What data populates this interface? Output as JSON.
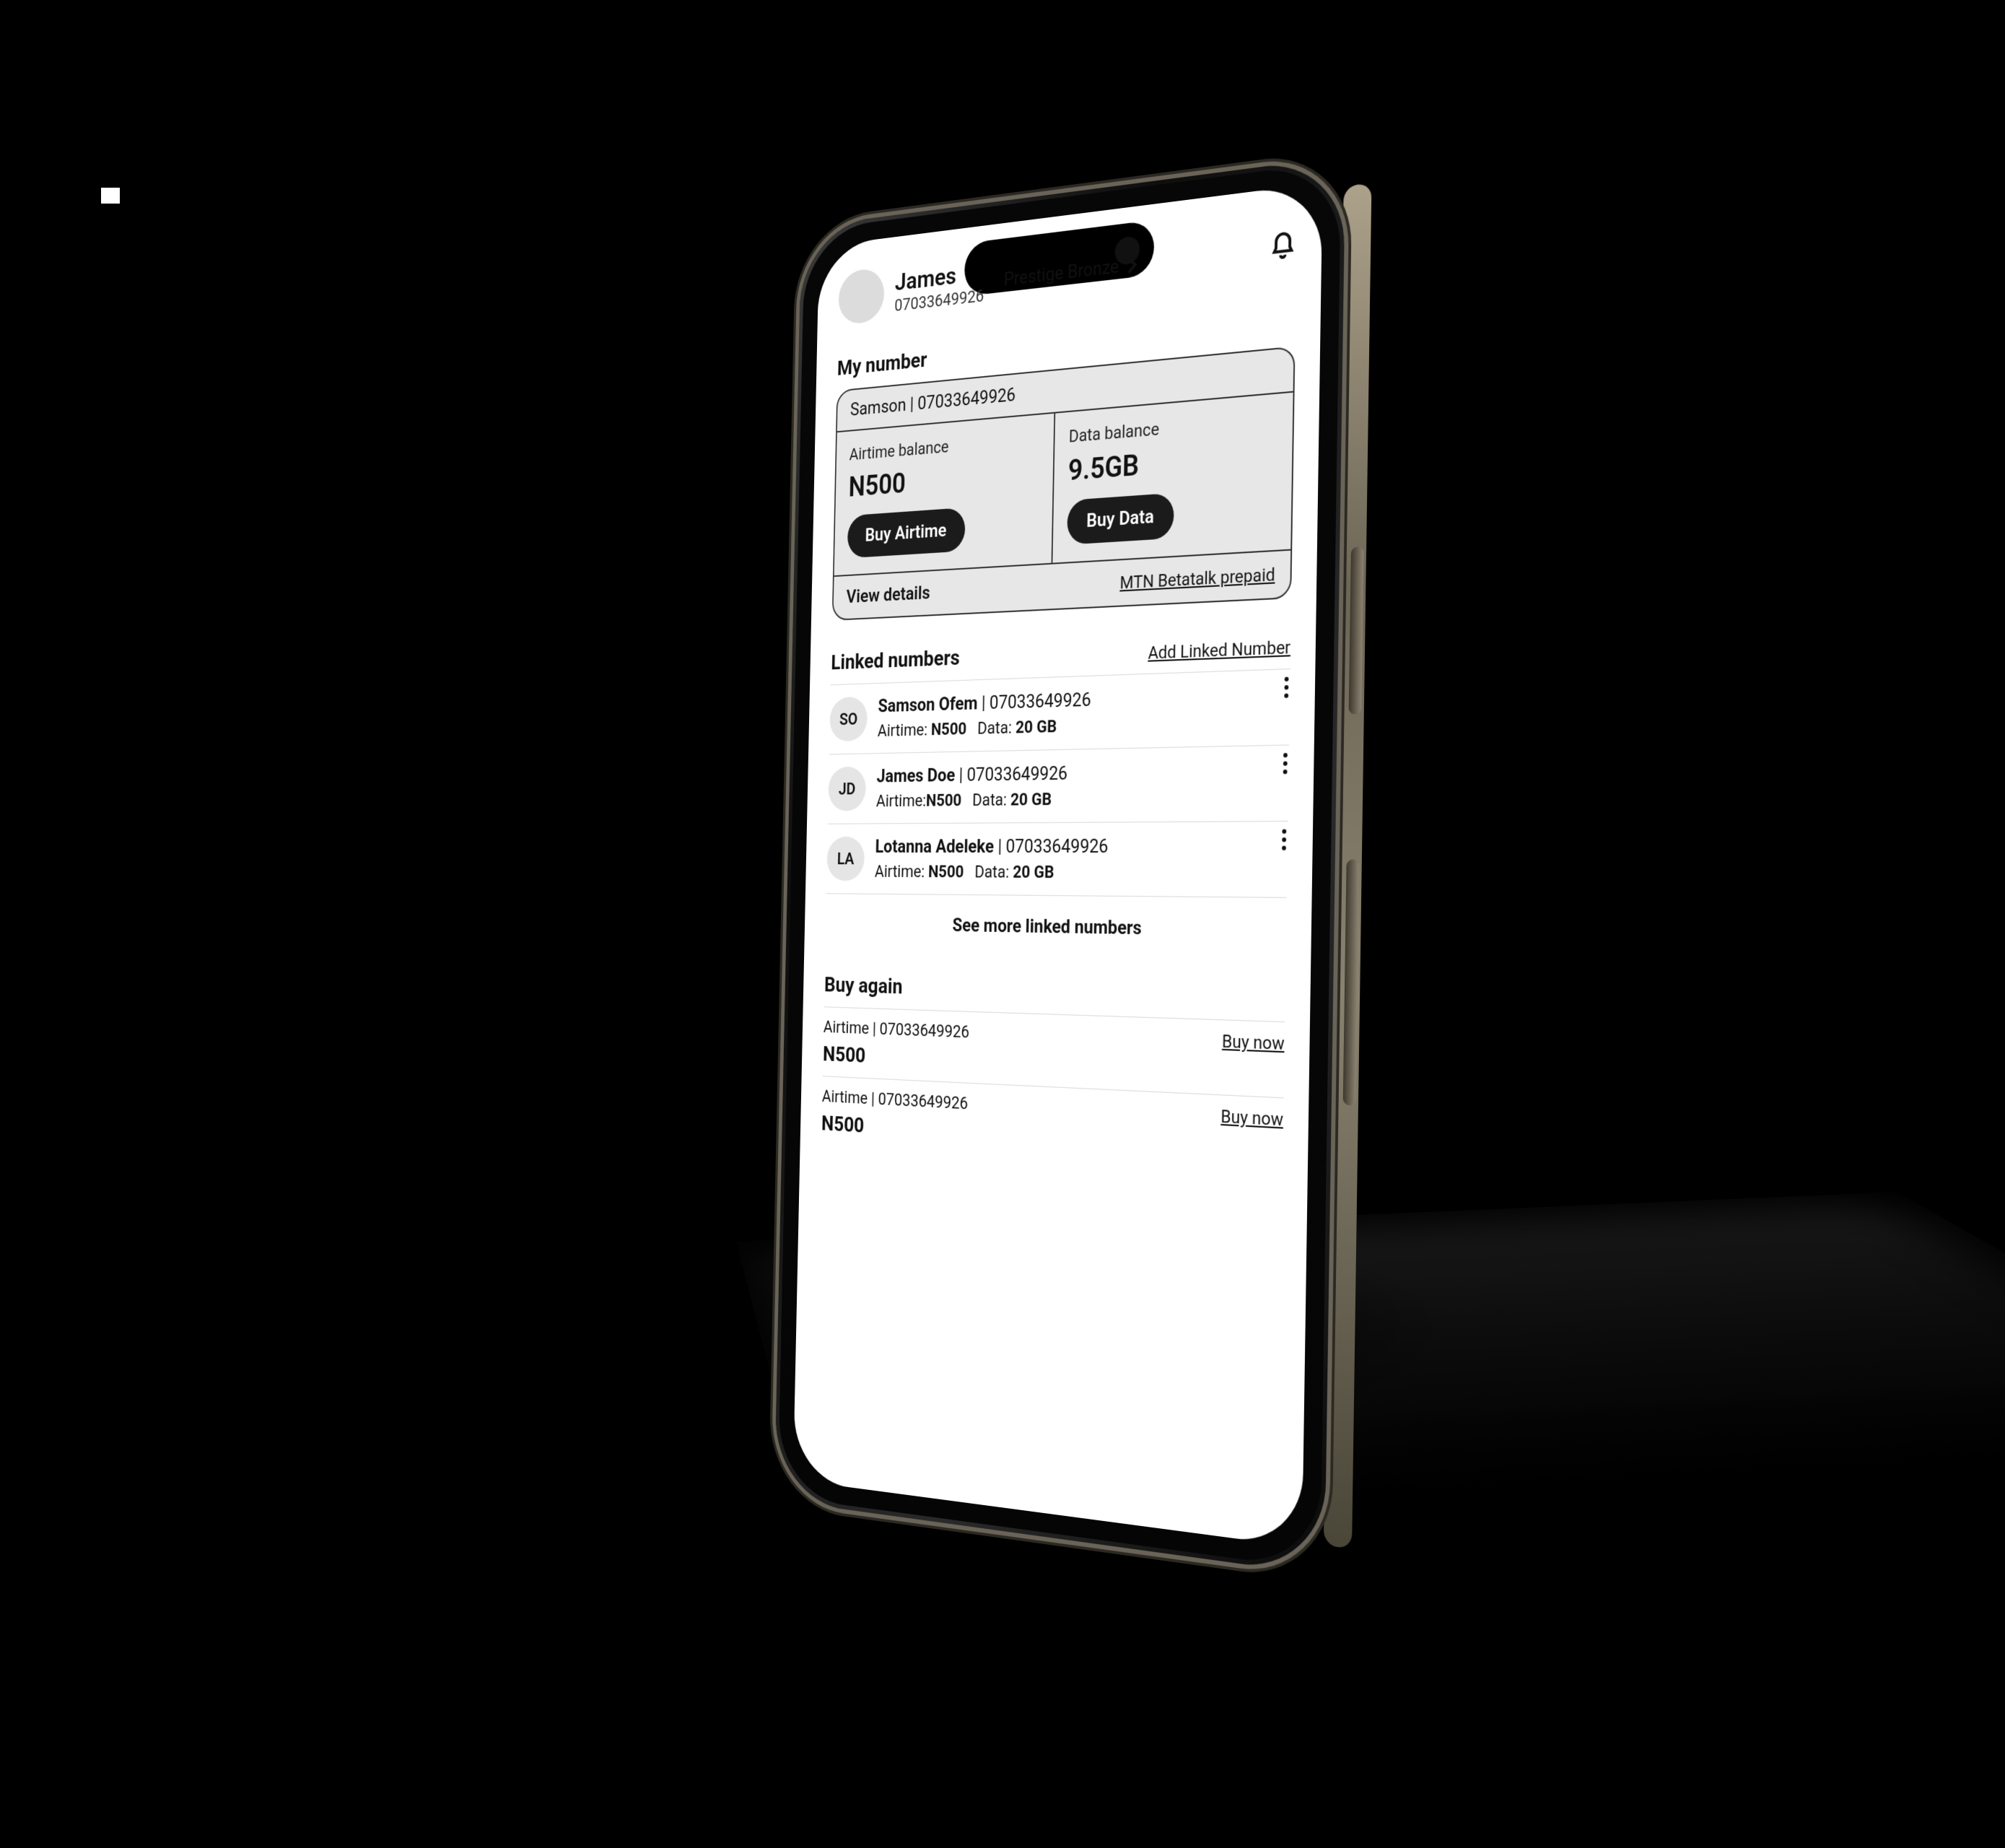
{
  "header": {
    "name": "James",
    "phone": "07033649926",
    "tier": "Prestige Bronze"
  },
  "myNumber": {
    "title": "My number",
    "owner": "Samson",
    "phone": "07033649926",
    "airtime": {
      "label": "Airtime balance",
      "value": "N500",
      "cta": "Buy Airtime"
    },
    "data": {
      "label": "Data balance",
      "value": "9.5GB",
      "cta": "Buy Data"
    },
    "viewDetails": "View details",
    "plan": "MTN Betatalk prepaid"
  },
  "linked": {
    "title": "Linked numbers",
    "addLabel": "Add Linked Number",
    "seeMore": "See more linked numbers",
    "items": [
      {
        "initials": "SO",
        "name": "Samson Ofem",
        "phone": "07033649926",
        "airtime": "N500",
        "data": "20 GB"
      },
      {
        "initials": "JD",
        "name": "James Doe",
        "phone": "07033649926",
        "airtime": "N500",
        "data": "20 GB"
      },
      {
        "initials": "LA",
        "name": "Lotanna Adeleke",
        "phone": "07033649926",
        "airtime": "N500",
        "data": "20 GB"
      }
    ]
  },
  "buyAgain": {
    "title": "Buy again",
    "cta": "Buy now",
    "items": [
      {
        "type": "Airtime",
        "phone": "07033649926",
        "amount": "N500"
      },
      {
        "type": "Airtime",
        "phone": "07033649926",
        "amount": "N500"
      }
    ]
  }
}
